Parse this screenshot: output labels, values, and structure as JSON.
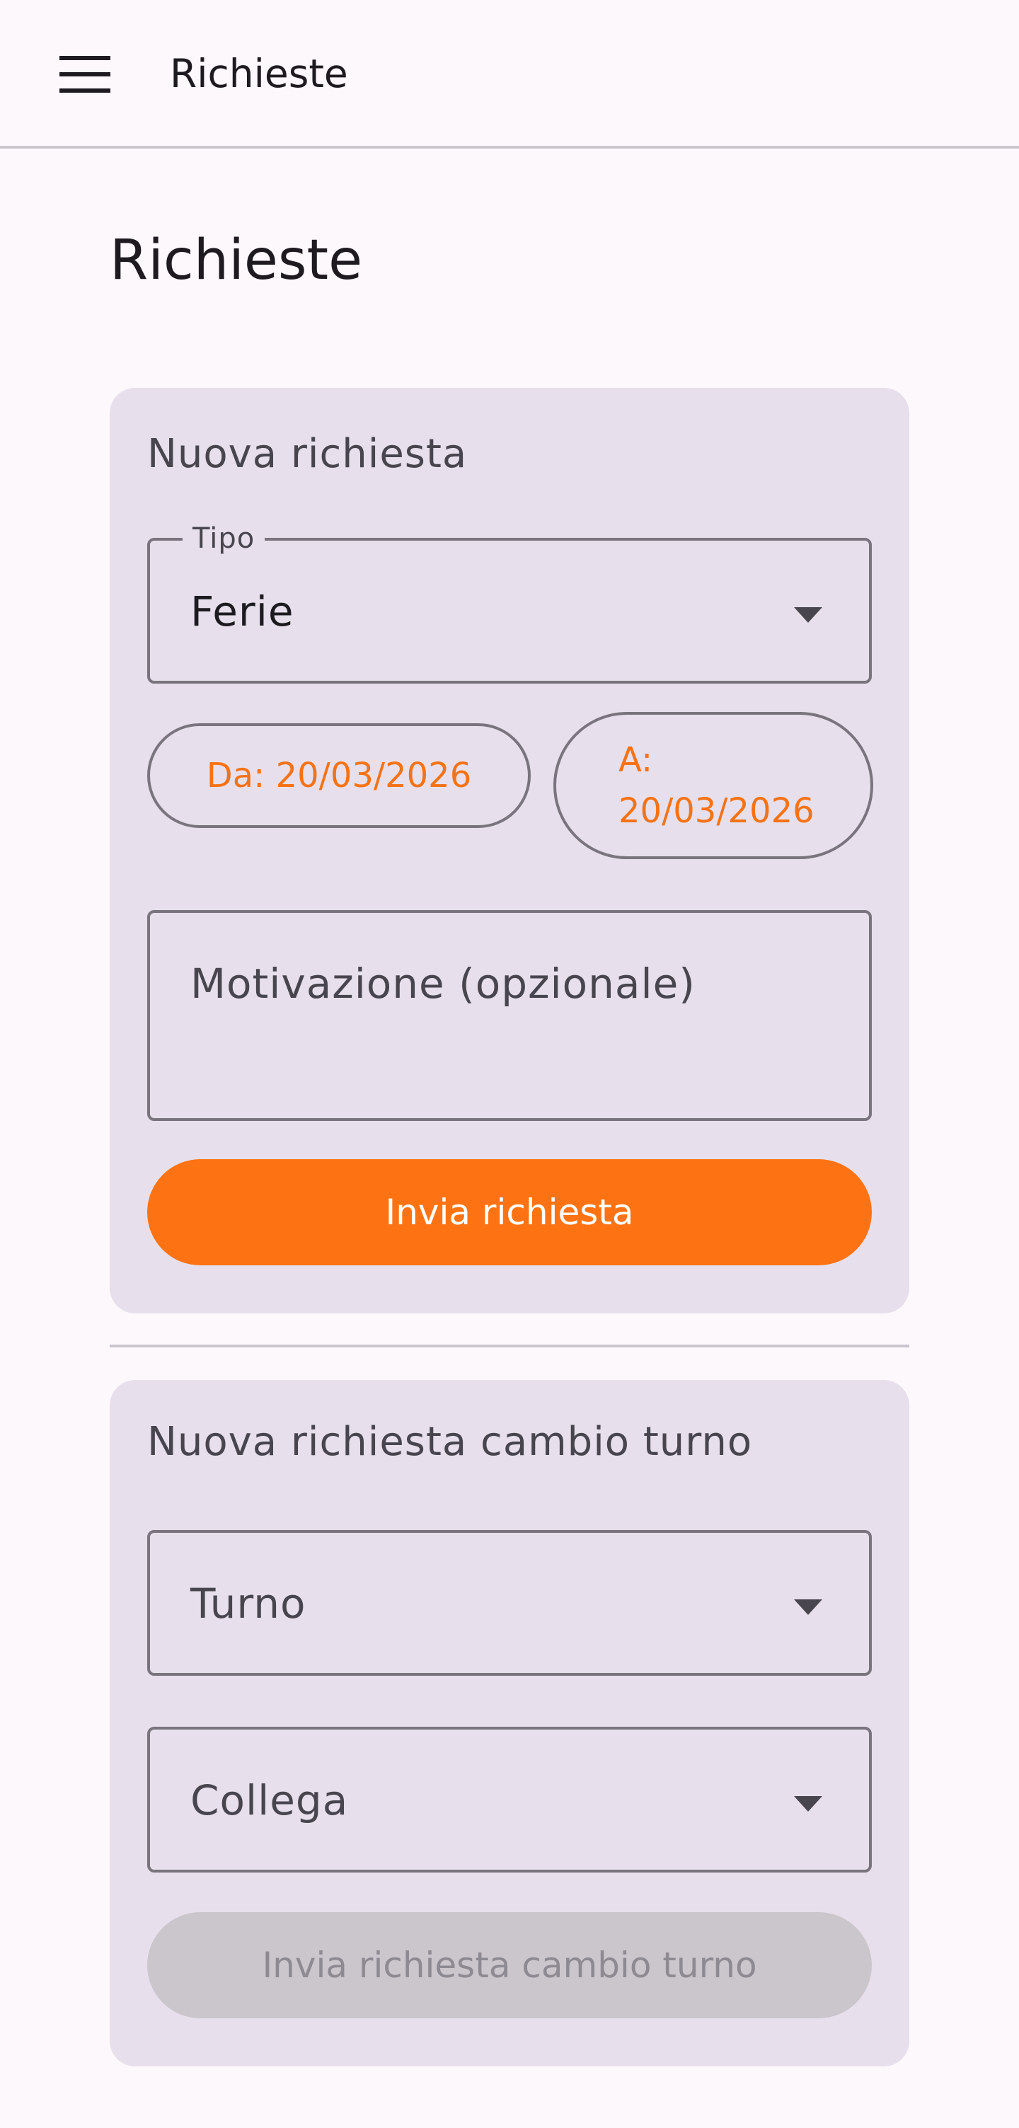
{
  "appbar": {
    "menu_icon": "hamburger-menu-icon",
    "title": "Richieste"
  },
  "page": {
    "title": "Richieste"
  },
  "request_form": {
    "title": "Nuova richiesta",
    "type_field": {
      "label": "Tipo",
      "value": "Ferie",
      "icon": "chevron-down-icon"
    },
    "date_from": "Da: 20/03/2026",
    "date_to_prefix": "A:",
    "date_to_value": "20/03/2026",
    "reason_placeholder": "Motivazione (opzionale)",
    "submit_label": "Invia richiesta"
  },
  "shift_change_form": {
    "title": "Nuova richiesta cambio turno",
    "shift_placeholder": "Turno",
    "colleague_placeholder": "Collega",
    "submit_label": "Invia richiesta cambio turno",
    "submit_enabled": false
  },
  "colors": {
    "accent": "#fd7313",
    "date_text": "#f57316",
    "card_background": "#e7e0ec",
    "page_background": "#fdf8fc",
    "disabled_button": "#cbc5cc"
  }
}
